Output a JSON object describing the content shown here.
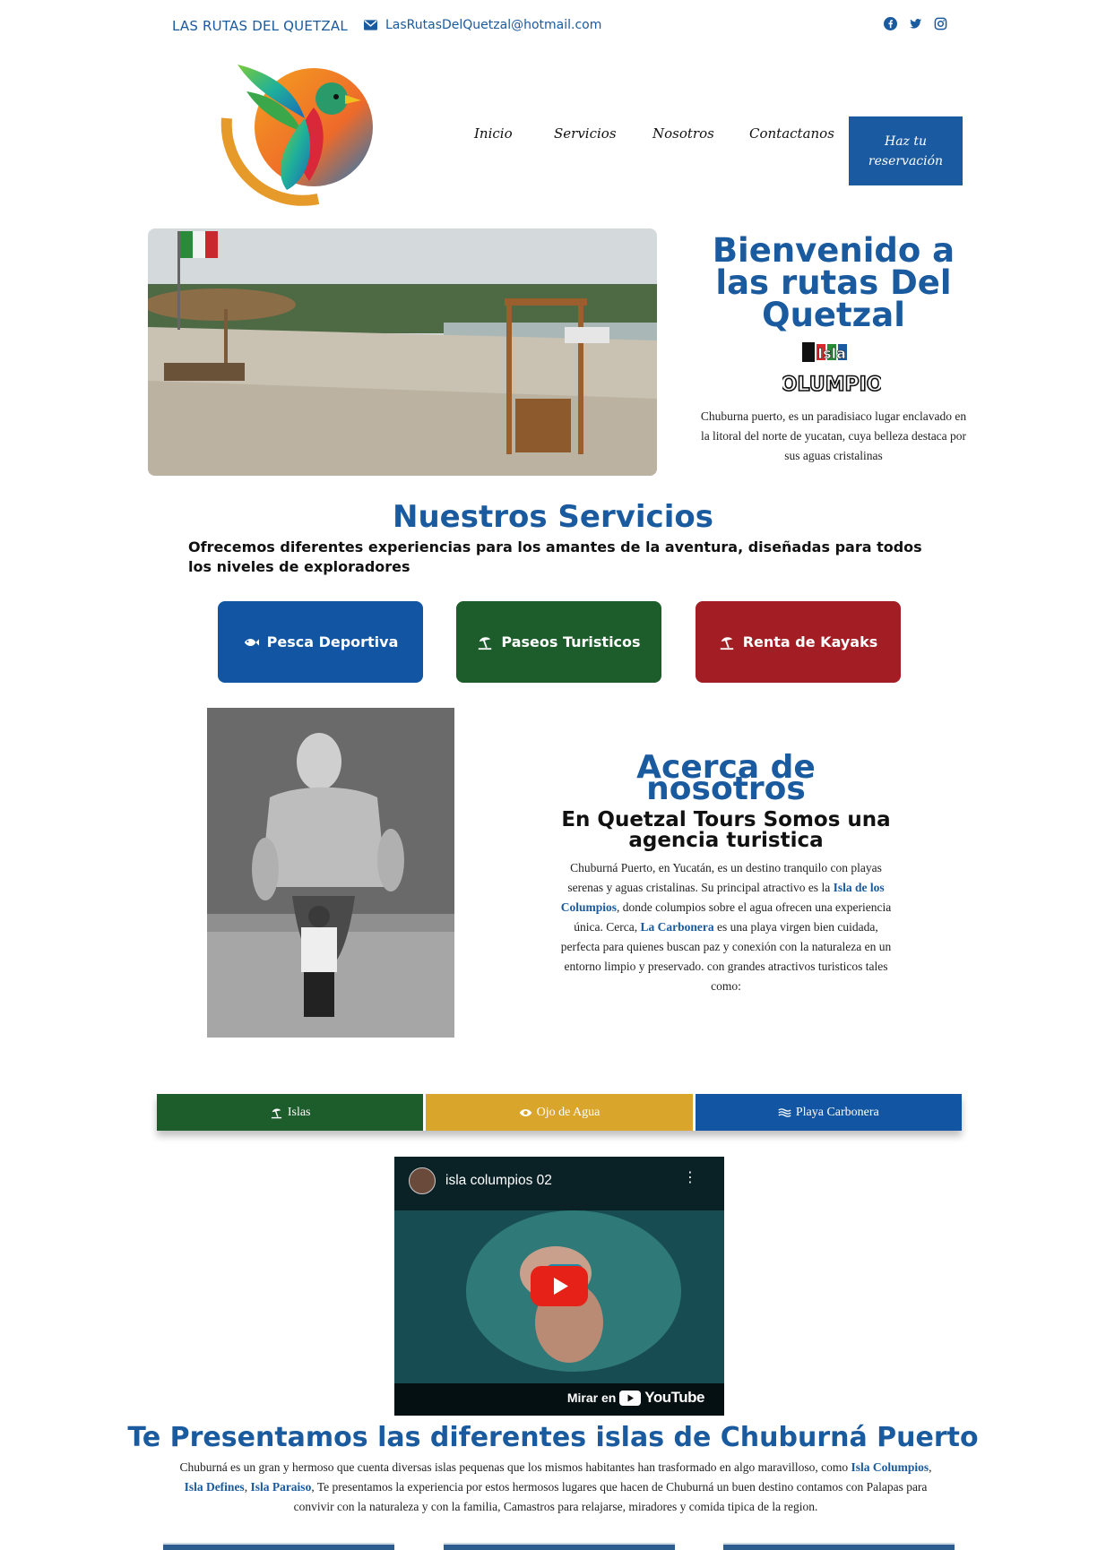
{
  "topbar": {
    "brand": "LAS RUTAS DEL QUETZAL",
    "email": "LasRutasDelQuetzal@hotmail.com",
    "socials": [
      "facebook-icon",
      "twitter-icon",
      "instagram-icon"
    ]
  },
  "logo": {
    "alt": "La Ruta del Quetzal"
  },
  "nav": {
    "items": [
      "Inicio",
      "Servicios",
      "Nosotros",
      "Contactanos"
    ],
    "cta": "Haz tu reservación"
  },
  "hero": {
    "title": "Bienvenido a las rutas Del Quetzal",
    "isla_logo_text": [
      "Isla",
      "COLUMPIOS"
    ],
    "description": "Chuburna puerto, es un paradisiaco lugar enclavado en la litoral del norte de yucatan, cuya belleza destaca por sus aguas cristalinas"
  },
  "services": {
    "title": "Nuestros Servicios",
    "subtitle": "Ofrecemos diferentes experiencias para los amantes de la aventura, diseñadas para todos los niveles de exploradores",
    "buttons": [
      {
        "label": "Pesca Deportiva",
        "icon": "fish-icon",
        "color": "#1256a3"
      },
      {
        "label": "Paseos Turisticos",
        "icon": "umbrella-beach-icon",
        "color": "#1d5c2b"
      },
      {
        "label": "Renta de Kayaks",
        "icon": "umbrella-beach-icon",
        "color": "#a31d24"
      }
    ]
  },
  "about": {
    "title": "Acerca de nosotros",
    "subtitle": "En Quetzal Tours Somos una agencia turistica",
    "text_parts": {
      "p1": "Chuburná Puerto, en Yucatán, es un destino tranquilo con playas serenas y aguas cristalinas. Su principal atractivo es la ",
      "hl1": "Isla de los Columpios",
      "p2": ", donde columpios sobre el agua ofrecen una experiencia única. Cerca, ",
      "hl2": "La Carbonera",
      "p3": " es una playa virgen bien cuidada, perfecta para quienes buscan paz y conexión con la naturaleza en un entorno limpio y preservado. con grandes atractivos turisticos tales como:"
    }
  },
  "tabs": [
    {
      "label": "Islas",
      "icon": "umbrella-beach-icon",
      "color": "#1d5c2b"
    },
    {
      "label": "Ojo de Agua",
      "icon": "eye-icon",
      "color": "#d9a52a"
    },
    {
      "label": "Playa Carbonera",
      "icon": "water-icon",
      "color": "#1256a3"
    }
  ],
  "video": {
    "title": "isla columpios 02",
    "watch_label": "Mirar en",
    "platform": "YouTube"
  },
  "islands": {
    "title": "Te Presentamos las diferentes islas de Chuburná Puerto",
    "text_parts": {
      "p1": "Chuburná es un gran y hermoso que cuenta diversas islas pequenas que los mismos habitantes han trasformado en algo maravilloso, como ",
      "hl1": "Isla Columpios",
      "sep1": ", ",
      "hl2": "Isla Defines",
      "sep2": ", ",
      "hl3": "Isla Paraiso",
      "p2": ", Te presentamos la experiencia por estos hermosos lugares que hacen de Chuburná un buen destino contamos con Palapas para convivir con la naturaleza y con la familia, Camastros para relajarse, miradores y comida tipica de la region."
    }
  }
}
